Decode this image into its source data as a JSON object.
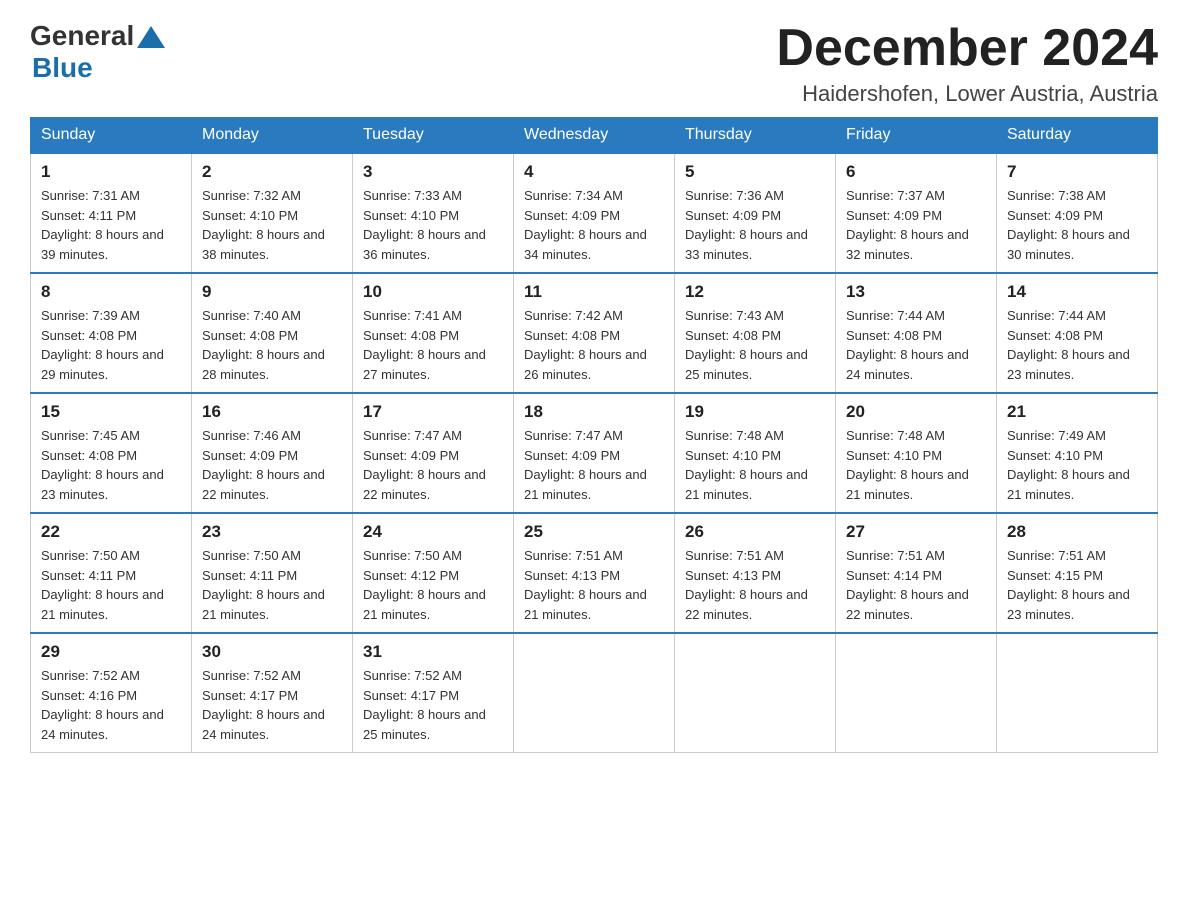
{
  "header": {
    "logo_general": "General",
    "logo_blue": "Blue",
    "month_title": "December 2024",
    "location": "Haidershofen, Lower Austria, Austria"
  },
  "days_of_week": [
    "Sunday",
    "Monday",
    "Tuesday",
    "Wednesday",
    "Thursday",
    "Friday",
    "Saturday"
  ],
  "weeks": [
    [
      {
        "day": "1",
        "sunrise": "7:31 AM",
        "sunset": "4:11 PM",
        "daylight": "8 hours and 39 minutes."
      },
      {
        "day": "2",
        "sunrise": "7:32 AM",
        "sunset": "4:10 PM",
        "daylight": "8 hours and 38 minutes."
      },
      {
        "day": "3",
        "sunrise": "7:33 AM",
        "sunset": "4:10 PM",
        "daylight": "8 hours and 36 minutes."
      },
      {
        "day": "4",
        "sunrise": "7:34 AM",
        "sunset": "4:09 PM",
        "daylight": "8 hours and 34 minutes."
      },
      {
        "day": "5",
        "sunrise": "7:36 AM",
        "sunset": "4:09 PM",
        "daylight": "8 hours and 33 minutes."
      },
      {
        "day": "6",
        "sunrise": "7:37 AM",
        "sunset": "4:09 PM",
        "daylight": "8 hours and 32 minutes."
      },
      {
        "day": "7",
        "sunrise": "7:38 AM",
        "sunset": "4:09 PM",
        "daylight": "8 hours and 30 minutes."
      }
    ],
    [
      {
        "day": "8",
        "sunrise": "7:39 AM",
        "sunset": "4:08 PM",
        "daylight": "8 hours and 29 minutes."
      },
      {
        "day": "9",
        "sunrise": "7:40 AM",
        "sunset": "4:08 PM",
        "daylight": "8 hours and 28 minutes."
      },
      {
        "day": "10",
        "sunrise": "7:41 AM",
        "sunset": "4:08 PM",
        "daylight": "8 hours and 27 minutes."
      },
      {
        "day": "11",
        "sunrise": "7:42 AM",
        "sunset": "4:08 PM",
        "daylight": "8 hours and 26 minutes."
      },
      {
        "day": "12",
        "sunrise": "7:43 AM",
        "sunset": "4:08 PM",
        "daylight": "8 hours and 25 minutes."
      },
      {
        "day": "13",
        "sunrise": "7:44 AM",
        "sunset": "4:08 PM",
        "daylight": "8 hours and 24 minutes."
      },
      {
        "day": "14",
        "sunrise": "7:44 AM",
        "sunset": "4:08 PM",
        "daylight": "8 hours and 23 minutes."
      }
    ],
    [
      {
        "day": "15",
        "sunrise": "7:45 AM",
        "sunset": "4:08 PM",
        "daylight": "8 hours and 23 minutes."
      },
      {
        "day": "16",
        "sunrise": "7:46 AM",
        "sunset": "4:09 PM",
        "daylight": "8 hours and 22 minutes."
      },
      {
        "day": "17",
        "sunrise": "7:47 AM",
        "sunset": "4:09 PM",
        "daylight": "8 hours and 22 minutes."
      },
      {
        "day": "18",
        "sunrise": "7:47 AM",
        "sunset": "4:09 PM",
        "daylight": "8 hours and 21 minutes."
      },
      {
        "day": "19",
        "sunrise": "7:48 AM",
        "sunset": "4:10 PM",
        "daylight": "8 hours and 21 minutes."
      },
      {
        "day": "20",
        "sunrise": "7:48 AM",
        "sunset": "4:10 PM",
        "daylight": "8 hours and 21 minutes."
      },
      {
        "day": "21",
        "sunrise": "7:49 AM",
        "sunset": "4:10 PM",
        "daylight": "8 hours and 21 minutes."
      }
    ],
    [
      {
        "day": "22",
        "sunrise": "7:50 AM",
        "sunset": "4:11 PM",
        "daylight": "8 hours and 21 minutes."
      },
      {
        "day": "23",
        "sunrise": "7:50 AM",
        "sunset": "4:11 PM",
        "daylight": "8 hours and 21 minutes."
      },
      {
        "day": "24",
        "sunrise": "7:50 AM",
        "sunset": "4:12 PM",
        "daylight": "8 hours and 21 minutes."
      },
      {
        "day": "25",
        "sunrise": "7:51 AM",
        "sunset": "4:13 PM",
        "daylight": "8 hours and 21 minutes."
      },
      {
        "day": "26",
        "sunrise": "7:51 AM",
        "sunset": "4:13 PM",
        "daylight": "8 hours and 22 minutes."
      },
      {
        "day": "27",
        "sunrise": "7:51 AM",
        "sunset": "4:14 PM",
        "daylight": "8 hours and 22 minutes."
      },
      {
        "day": "28",
        "sunrise": "7:51 AM",
        "sunset": "4:15 PM",
        "daylight": "8 hours and 23 minutes."
      }
    ],
    [
      {
        "day": "29",
        "sunrise": "7:52 AM",
        "sunset": "4:16 PM",
        "daylight": "8 hours and 24 minutes."
      },
      {
        "day": "30",
        "sunrise": "7:52 AM",
        "sunset": "4:17 PM",
        "daylight": "8 hours and 24 minutes."
      },
      {
        "day": "31",
        "sunrise": "7:52 AM",
        "sunset": "4:17 PM",
        "daylight": "8 hours and 25 minutes."
      },
      null,
      null,
      null,
      null
    ]
  ]
}
